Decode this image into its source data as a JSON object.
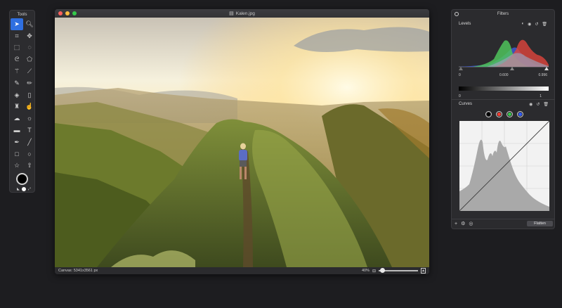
{
  "tools_panel": {
    "title": "Tools",
    "tools": [
      {
        "icon": "arrow-icon",
        "glyph": "➤",
        "active": true
      },
      {
        "icon": "zoom-icon",
        "glyph": "🔍︎",
        "active": false
      },
      {
        "icon": "crop-icon",
        "glyph": "⌗",
        "active": false
      },
      {
        "icon": "transform-icon",
        "glyph": "✥",
        "active": false
      },
      {
        "icon": "rect-select-icon",
        "glyph": "⬚",
        "active": false
      },
      {
        "icon": "ellipse-select-icon",
        "glyph": "◌",
        "active": false
      },
      {
        "icon": "lasso-icon",
        "glyph": "ᘓ",
        "active": false
      },
      {
        "icon": "poly-lasso-icon",
        "glyph": "⬠",
        "active": false
      },
      {
        "icon": "magic-wand-icon",
        "glyph": "⚚",
        "active": false
      },
      {
        "icon": "quick-select-icon",
        "glyph": "⟋",
        "active": false
      },
      {
        "icon": "brush-icon",
        "glyph": "✎",
        "active": false
      },
      {
        "icon": "pencil-icon",
        "glyph": "✏",
        "active": false
      },
      {
        "icon": "fill-icon",
        "glyph": "◈",
        "active": false
      },
      {
        "icon": "eraser-icon",
        "glyph": "▯",
        "active": false
      },
      {
        "icon": "stamp-icon",
        "glyph": "♜",
        "active": false
      },
      {
        "icon": "smudge-icon",
        "glyph": "☝",
        "active": false
      },
      {
        "icon": "cloud-icon",
        "glyph": "☁",
        "active": false
      },
      {
        "icon": "sun-icon",
        "glyph": "☼",
        "active": false
      },
      {
        "icon": "gradient-icon",
        "glyph": "▬",
        "active": false
      },
      {
        "icon": "text-icon",
        "glyph": "T",
        "active": false
      },
      {
        "icon": "pen-icon",
        "glyph": "✒",
        "active": false
      },
      {
        "icon": "line-icon",
        "glyph": "╱",
        "active": false
      },
      {
        "icon": "rectangle-icon",
        "glyph": "□",
        "active": false
      },
      {
        "icon": "ellipse-icon",
        "glyph": "○",
        "active": false
      },
      {
        "icon": "star-icon",
        "glyph": "☆",
        "active": false
      },
      {
        "icon": "arrow-up-icon",
        "glyph": "⇧",
        "active": false
      }
    ],
    "swatch_colors": {
      "foreground": "#000000",
      "background": "#ffffff"
    }
  },
  "window": {
    "title": "Kalen.jpg",
    "traffic_lights": [
      "#fc605c",
      "#fdbc40",
      "#34c84a"
    ],
    "status": {
      "canvas": "Canvas: 5341x3561 px",
      "zoom": "40%"
    }
  },
  "filters": {
    "title": "Filters",
    "levels": {
      "label": "Levels",
      "input_low": "0",
      "input_mid": "0.600",
      "input_high": "0.996",
      "output_low": "0",
      "output_high": "1"
    },
    "curves": {
      "label": "Curves",
      "channels": [
        "#000000",
        "#ff3b30",
        "#34c84a",
        "#2f5bff"
      ]
    },
    "flatten_label": "Flatten"
  }
}
